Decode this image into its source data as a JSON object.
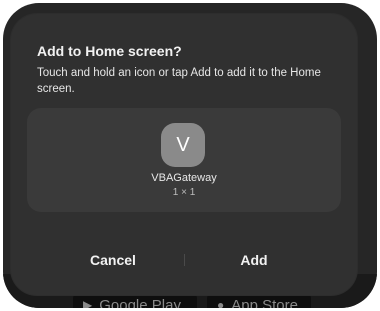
{
  "background": {
    "badges": [
      {
        "icon": "play-store-icon",
        "label": "Google Play"
      },
      {
        "icon": "apple-icon",
        "label": "App Store"
      }
    ]
  },
  "dialog": {
    "title": "Add to Home screen?",
    "message": "Touch and hold an icon or tap Add to add it to the Home screen.",
    "app": {
      "icon_letter": "V",
      "name": "VBAGateway",
      "size": "1 × 1"
    },
    "cancel_label": "Cancel",
    "add_label": "Add"
  },
  "colors": {
    "dialog_bg": "#303030",
    "preview_bg": "#3a3a3a",
    "app_icon_bg": "#8a8a8a"
  }
}
